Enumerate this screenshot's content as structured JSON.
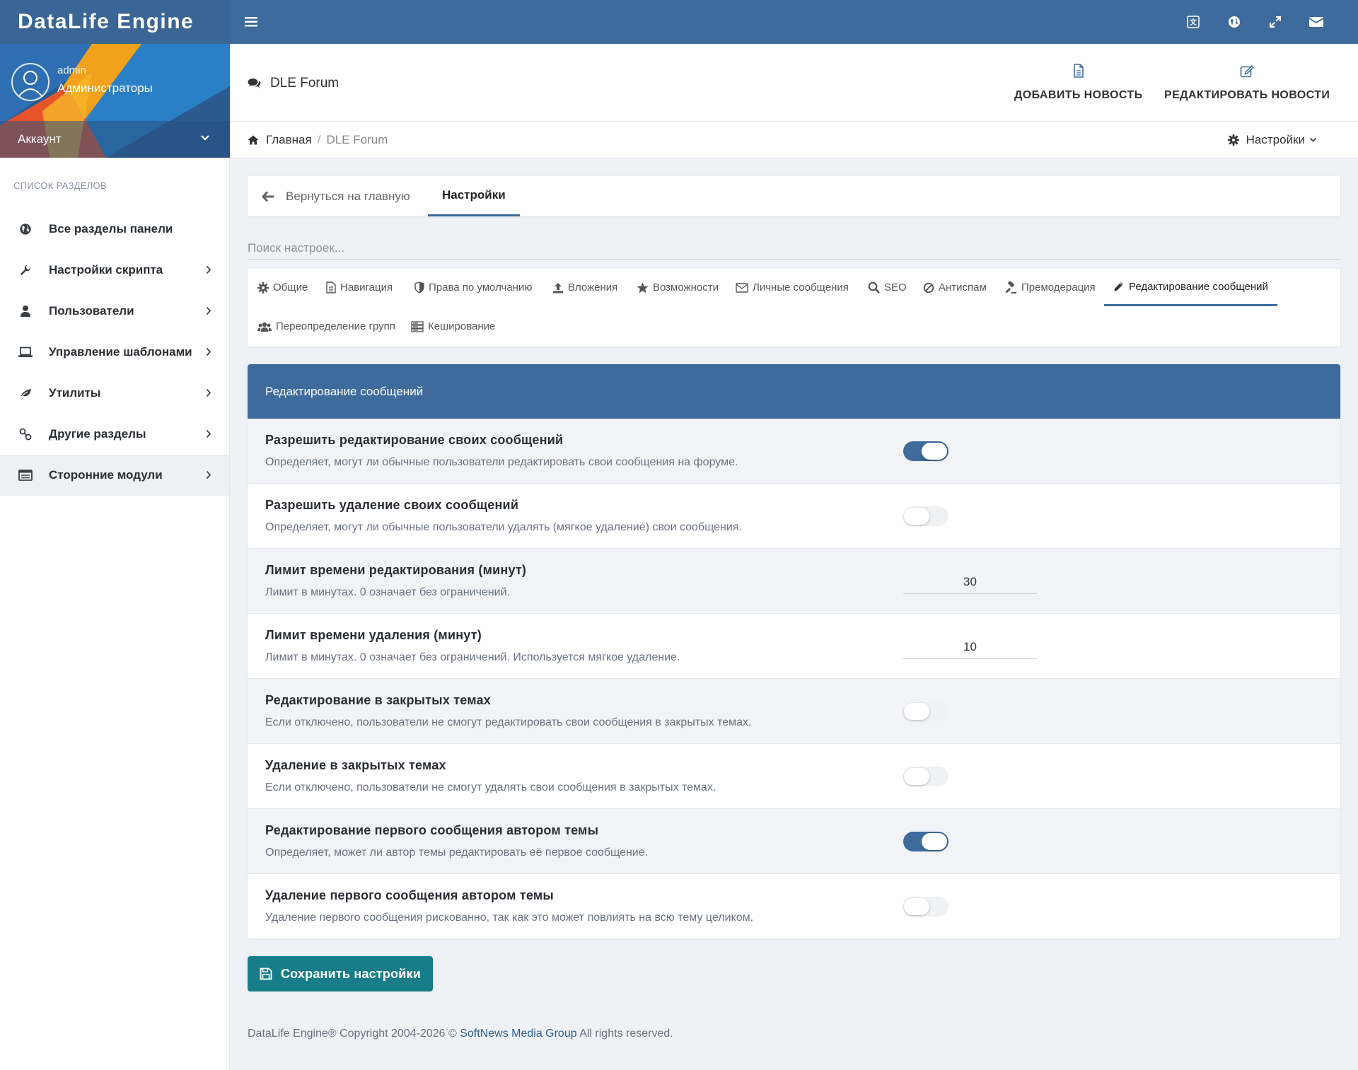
{
  "brand": "DataLife Engine",
  "user": {
    "name": "admin",
    "role": "Администраторы",
    "account_label": "Аккаунт"
  },
  "sidebar": {
    "caption": "СПИСОК РАЗДЕЛОВ",
    "items": [
      {
        "label": "Все разделы панели",
        "icon": "globe-icon",
        "has_arrow": false
      },
      {
        "label": "Настройки скрипта",
        "icon": "wrench-icon",
        "has_arrow": true
      },
      {
        "label": "Пользователи",
        "icon": "user-icon",
        "has_arrow": true
      },
      {
        "label": "Управление шаблонами",
        "icon": "laptop-icon",
        "has_arrow": true
      },
      {
        "label": "Утилиты",
        "icon": "leaf-icon",
        "has_arrow": true
      },
      {
        "label": "Другие разделы",
        "icon": "link-icon",
        "has_arrow": true
      },
      {
        "label": "Сторонние модули",
        "icon": "list-icon",
        "has_arrow": true,
        "active": true
      }
    ]
  },
  "header": {
    "title": "DLE Forum",
    "actions": [
      {
        "label": "ДОБАВИТЬ НОВОСТЬ",
        "icon": "file-icon"
      },
      {
        "label": "РЕДАКТИРОВАТЬ НОВОСТИ",
        "icon": "edit-icon"
      }
    ]
  },
  "breadcrumb": {
    "home": "Главная",
    "separator": "/",
    "current": "DLE Forum",
    "settings": "Настройки"
  },
  "tabs": {
    "back": "Вернуться на главную",
    "active": "Настройки"
  },
  "search": {
    "placeholder": "Поиск настроек...",
    "value": ""
  },
  "subnav": [
    {
      "label": "Общие",
      "icon": "gear-icon"
    },
    {
      "label": "Навигация",
      "icon": "document-icon"
    },
    {
      "label": "Права по умолчанию",
      "icon": "shield-icon"
    },
    {
      "label": "Вложения",
      "icon": "upload-icon"
    },
    {
      "label": "Возможности",
      "icon": "star-icon"
    },
    {
      "label": "Личные сообщения",
      "icon": "envelope-icon"
    },
    {
      "label": "SEO",
      "icon": "search-icon"
    },
    {
      "label": "Антиспам",
      "icon": "ban-icon"
    },
    {
      "label": "Премодерация",
      "icon": "gavel-icon"
    },
    {
      "label": "Редактирование сообщений",
      "icon": "pencil-icon",
      "active": true
    },
    {
      "label": "Переопределение групп",
      "icon": "users-icon"
    },
    {
      "label": "Кеширование",
      "icon": "server-icon"
    }
  ],
  "panel": {
    "title": "Редактирование сообщений",
    "settings": [
      {
        "title": "Разрешить редактирование своих сообщений",
        "desc": "Определяет, могут ли обычные пользователи редактировать свои сообщения на форуме.",
        "type": "toggle",
        "value": true
      },
      {
        "title": "Разрешить удаление своих сообщений",
        "desc": "Определяет, могут ли обычные пользователи удалять (мягкое удаление) свои сообщения.",
        "type": "toggle",
        "value": false
      },
      {
        "title": "Лимит времени редактирования (минут)",
        "desc": "Лимит в минутах. 0 означает без ограничений.",
        "type": "number",
        "value": "30"
      },
      {
        "title": "Лимит времени удаления (минут)",
        "desc": "Лимит в минутах. 0 означает без ограничений. Используется мягкое удаление.",
        "type": "number",
        "value": "10"
      },
      {
        "title": "Редактирование в закрытых темах",
        "desc": "Если отключено, пользователи не смогут редактировать свои сообщения в закрытых темах.",
        "type": "toggle",
        "value": false
      },
      {
        "title": "Удаление в закрытых темах",
        "desc": "Если отключено, пользователи не смогут удалять свои сообщения в закрытых темах.",
        "type": "toggle",
        "value": false
      },
      {
        "title": "Редактирование первого сообщения автором темы",
        "desc": "Определяет, может ли автор темы редактировать её первое сообщение.",
        "type": "toggle",
        "value": true
      },
      {
        "title": "Удаление первого сообщения автором темы",
        "desc": "Удаление первого сообщения рискованно, так как это может повлиять на всю тему целиком.",
        "type": "toggle",
        "value": false
      }
    ]
  },
  "save_label": "Сохранить настройки",
  "footer": {
    "prefix": "DataLife Engine® Copyright 2004-2026 ©",
    "link": "SoftNews Media Group",
    "suffix": "All rights reserved."
  },
  "colors": {
    "primary": "#3e6b9c",
    "save": "#177e89",
    "link": "#2d5f8f"
  }
}
